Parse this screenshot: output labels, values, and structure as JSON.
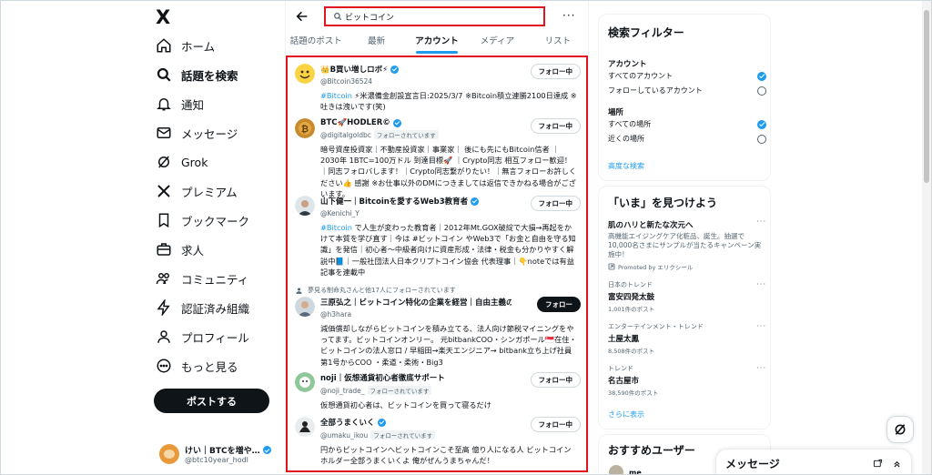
{
  "nav": {
    "logo": "X",
    "items": [
      {
        "key": "home",
        "label": "ホーム",
        "icon": "home-icon"
      },
      {
        "key": "explore",
        "label": "話題を検索",
        "icon": "search-icon"
      },
      {
        "key": "notifications",
        "label": "通知",
        "icon": "bell-icon"
      },
      {
        "key": "messages",
        "label": "メッセージ",
        "icon": "mail-icon"
      },
      {
        "key": "grok",
        "label": "Grok",
        "icon": "grok-icon"
      },
      {
        "key": "premium",
        "label": "プレミアム",
        "icon": "x-logo-icon"
      },
      {
        "key": "bookmarks",
        "label": "ブックマーク",
        "icon": "bookmark-icon"
      },
      {
        "key": "jobs",
        "label": "求人",
        "icon": "briefcase-icon"
      },
      {
        "key": "communities",
        "label": "コミュニティ",
        "icon": "people-icon"
      },
      {
        "key": "verified-orgs",
        "label": "認証済み組織",
        "icon": "lightning-icon"
      },
      {
        "key": "profile",
        "label": "プロフィール",
        "icon": "person-icon"
      },
      {
        "key": "more",
        "label": "もっと見る",
        "icon": "more-circle-icon"
      }
    ],
    "post_button": "ポストする",
    "account": {
      "name": "けい｜BTCを増や…",
      "handle": "@btc10year_hodl"
    }
  },
  "search": {
    "value": "ビットコイン",
    "more": "···"
  },
  "tabs": [
    "話題のポスト",
    "最新",
    "アカウント",
    "メディア",
    "リスト"
  ],
  "active_tab": 2,
  "accounts": [
    {
      "name": "👑B買い増しロボ⚡",
      "verified": true,
      "handle": "@Bitcoin36524",
      "follows_you": "",
      "button": "フォロー中",
      "bio_hl": "#Bitcoin",
      "bio": " ⚡米濃備金創設宣言日:2025/3/7 ※Bitcoin積立連勝2100日達成 ※吐きは洩いです(笑)"
    },
    {
      "name": "BTC🚀HODLER©",
      "verified": true,
      "handle": "@digitalgoldbc",
      "follows_you": "フォローされています",
      "button": "フォロー中",
      "bio_hl": "",
      "bio": "暗号資産投資家｜不動産投資家｜事業家｜ 後にも先にもBitcoin信者 ｜2030年 1BTC=100万ドル 到達目標🚀 ｜Crypto同志 相互フォロー歓迎！ ｜同志フォロバします！｜Crypto同志繋がりたい！｜無言フォローお許しください👍 感謝 ※お仕事以外のDMにつきましては返信できかねる場合がございます。"
    },
    {
      "name": "山下健一｜Bitcoinを愛するWeb3教育者",
      "verified": true,
      "handle": "@Kenichi_Y",
      "follows_you": "",
      "button": "フォロー中",
      "bio_hl": "#Bitcoin",
      "bio": " で人生が変わった教育者｜2012年Mt.GOX破綻で大損→再起をかけて本質を学び直す｜今は #ビットコイン やWeb3で「お金と自由を守る知識」を発信｜初心者〜中級者向けに資産形成・法律・税金も分かりやすく解説中📘｜一般社団法人日本クリプトコイン協会 代表理事｜👇noteでは有益記事を連載中"
    },
    {
      "name": "三原弘之｜ビットコイン特化の企業を経営｜自由主義の…",
      "verified": true,
      "handle": "@h3hara",
      "follows_you": "",
      "button": "フォロー",
      "bio_hl": "",
      "bio": "減価償却しながらビットコインを積み立てる、法人向け節税マイニングをやってます。ビットコインオンリー。 元bitbankCOO・シンガポール🇸🇬在住・ビットコインの法人窓口 / 早稲田→楽天エンジニア→ bitbank立ち上げ社員第1号からCOO ・柔道・柔術・Big3"
    },
    {
      "name": "noji｜仮想通貨初心者徹底サポート",
      "verified": false,
      "handle": "@noji_trade_",
      "follows_you": "フォローされています",
      "button": "フォロー中",
      "bio_hl": "",
      "bio": "仮想通貨初心者は、ビットコインを買って寝るだけ"
    },
    {
      "name": "全部うまくいく",
      "verified": true,
      "handle": "@umaku_ikou",
      "follows_you": "フォローされています",
      "button": "フォロー中",
      "bio_hl": "",
      "bio": "円からビットコインへビットコインこそ至高 億り人になる人 ビットコインホルダー全部うまくいくよ 俺がぜんうまちゃんだ！"
    }
  ],
  "social_context": "夢見る制命丸さんと他17人にフォローされています",
  "filters": {
    "title": "検索フィルター",
    "account_label": "アカウント",
    "account_options": [
      "すべてのアカウント",
      "フォローしているアカウント"
    ],
    "place_label": "場所",
    "place_options": [
      "すべての場所",
      "近くの場所"
    ],
    "advanced": "高度な検索"
  },
  "trends": {
    "title": "「いま」を見つけよう",
    "ad": {
      "title": "肌のハリと新たな次元へ",
      "desc": "高機能エイジングケア化粧品、誕生。抽選で10,000名さまにサンプルが当たるキャンペーン実施中！",
      "promoted": "Promoted by エリクシール"
    },
    "items": [
      {
        "cat": "日本のトレンド",
        "title": "富安四発太鼓",
        "count": "1,001件のポスト"
      },
      {
        "cat": "エンターテインメント・トレンド",
        "title": "土屋太鳳",
        "count": "8,508件のポスト"
      },
      {
        "cat": "トレンド",
        "title": "名古屋市",
        "count": "38,590件のポスト"
      }
    ],
    "show_more": "さらに表示"
  },
  "who_to_follow": {
    "title": "おすすめユーザー",
    "first": "me"
  },
  "messages_bar": "メッセージ",
  "colors": {
    "accent": "#1d9bf0",
    "highlight": "#e0141e",
    "text": "#0f1419",
    "muted": "#536471"
  }
}
